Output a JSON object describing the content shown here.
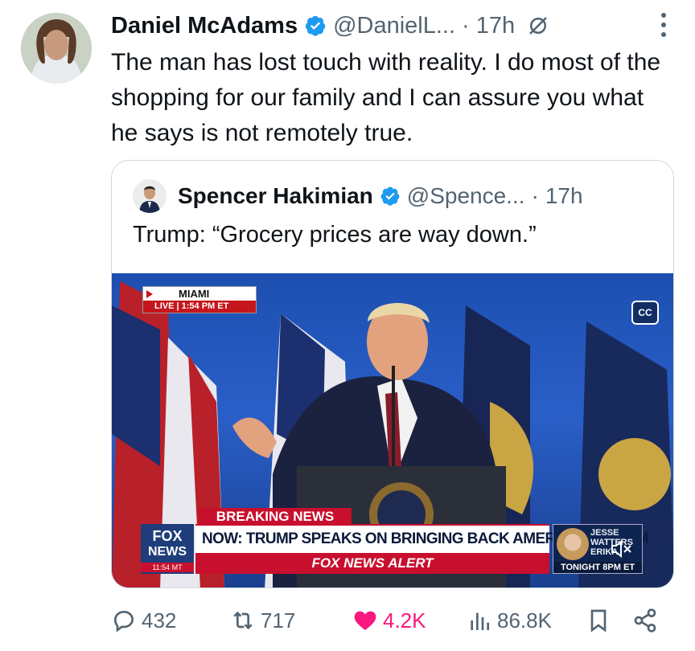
{
  "tweet": {
    "author_name": "Daniel McAdams",
    "author_handle": "@DanielL...",
    "separator": "·",
    "time": "17h",
    "text": "The man has lost touch with reality. I do most of the shopping for our family and I can assure you what he says is not remotely true."
  },
  "quoted_tweet": {
    "author_name": "Spencer Hakimian",
    "author_handle": "@Spence...",
    "separator": "·",
    "time": "17h",
    "text": "Trump: “Grocery prices are way down.”",
    "video": {
      "location": "MIAMI",
      "live_label": "LIVE | 1:54 PM ET",
      "cc_label": "CC",
      "breaking_label": "BREAKING NEWS",
      "headline": "NOW: TRUMP SPEAKS ON BRINGING BACK AMERICAN DREAM",
      "alert": "FOX NEWS ALERT",
      "logo_line1": "FOX",
      "logo_line2": "NEWS",
      "logo_time": "11:54 MT",
      "promo_line1": "JESSE",
      "promo_line2": "WATTERS",
      "promo_line3": "ERIKA",
      "promo_tonight": "TONIGHT 8PM ET"
    }
  },
  "actions": {
    "replies": "432",
    "reposts": "717",
    "likes": "4.2K",
    "views": "86.8K"
  },
  "colors": {
    "text": "#0f1419",
    "muted": "#536471",
    "verified": "#1d9bf0",
    "like": "#f91880",
    "border": "#cfd9de"
  }
}
